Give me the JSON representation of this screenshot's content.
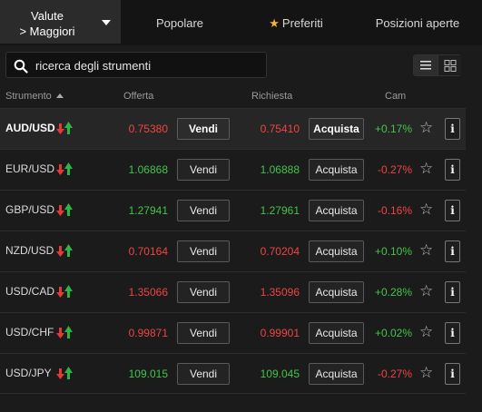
{
  "tabs": {
    "category_line1": "Valute",
    "category_line2": "> Maggiori",
    "popular": "Popolare",
    "favorites_star": "★",
    "favorites": "Preferiti",
    "open_positions": "Posizioni aperte"
  },
  "search": {
    "placeholder": "ricerca degli strumenti"
  },
  "columns": {
    "instrument": "Strumento",
    "bid": "Offerta",
    "ask": "Richiesta",
    "change": "Cam"
  },
  "actions": {
    "sell": "Vendi",
    "buy": "Acquista",
    "info": "i",
    "fav": "☆"
  },
  "colors": {
    "up": "#44c44a",
    "down": "#f04444",
    "favorites_star": "#f0b43a"
  },
  "rows": [
    {
      "symbol": "AUD/USD",
      "bid": "0.75380",
      "ask": "0.75410",
      "change": "+0.17%",
      "price_dir": "down",
      "change_dir": "up"
    },
    {
      "symbol": "EUR/USD",
      "bid": "1.06868",
      "ask": "1.06888",
      "change": "-0.27%",
      "price_dir": "up",
      "change_dir": "down"
    },
    {
      "symbol": "GBP/USD",
      "bid": "1.27941",
      "ask": "1.27961",
      "change": "-0.16%",
      "price_dir": "up",
      "change_dir": "down"
    },
    {
      "symbol": "NZD/USD",
      "bid": "0.70164",
      "ask": "0.70204",
      "change": "+0.10%",
      "price_dir": "down",
      "change_dir": "up"
    },
    {
      "symbol": "USD/CAD",
      "bid": "1.35066",
      "ask": "1.35096",
      "change": "+0.28%",
      "price_dir": "down",
      "change_dir": "up"
    },
    {
      "symbol": "USD/CHF",
      "bid": "0.99871",
      "ask": "0.99901",
      "change": "+0.02%",
      "price_dir": "down",
      "change_dir": "up"
    },
    {
      "symbol": "USD/JPY",
      "bid": "109.015",
      "ask": "109.045",
      "change": "-0.27%",
      "price_dir": "up",
      "change_dir": "down"
    }
  ]
}
